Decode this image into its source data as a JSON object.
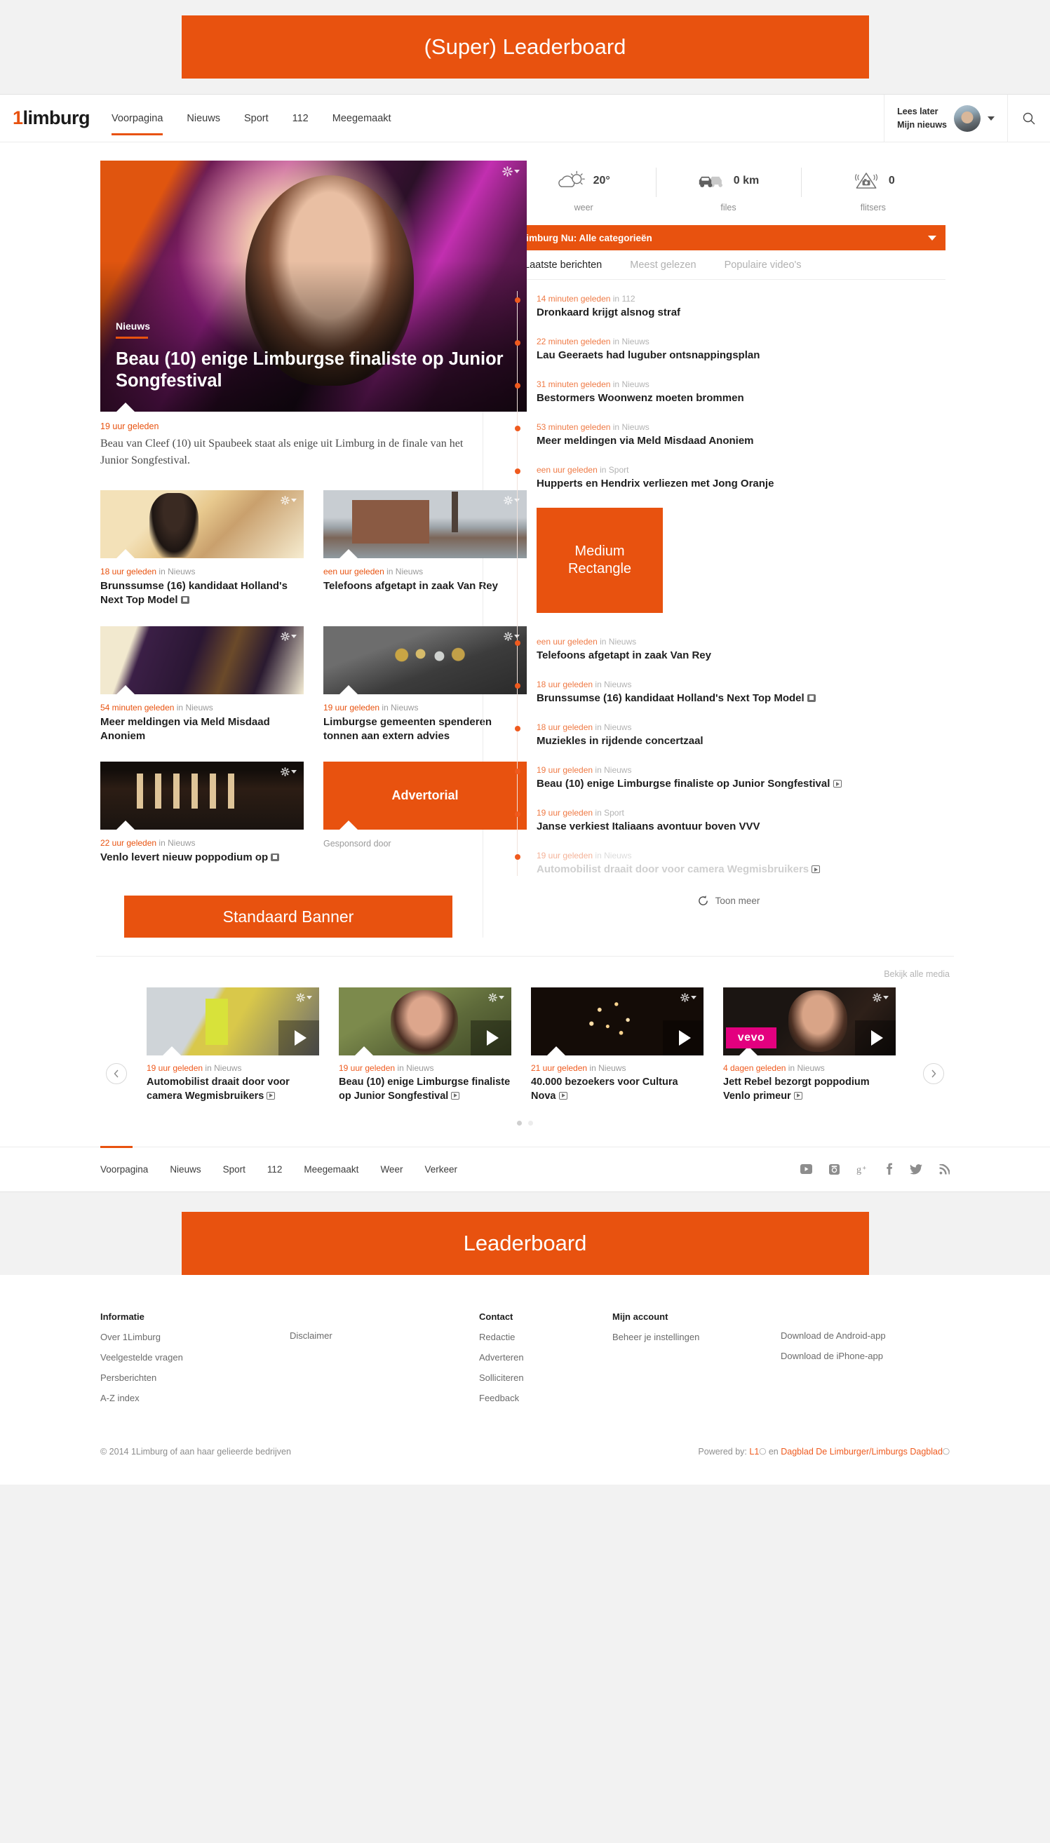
{
  "ads": {
    "super_leaderboard": "(Super) Leaderboard",
    "medium_rectangle_line1": "Medium",
    "medium_rectangle_line2": "Rectangle",
    "standaard_banner": "Standaard Banner",
    "leaderboard": "Leaderboard",
    "advertorial": "Advertorial",
    "advertorial_sub": "Gesponsord door"
  },
  "header": {
    "logo_one": "1",
    "logo_rest": "limburg",
    "nav": [
      {
        "label": "Voorpagina",
        "active": true
      },
      {
        "label": "Nieuws",
        "active": false
      },
      {
        "label": "Sport",
        "active": false
      },
      {
        "label": "112",
        "active": false
      },
      {
        "label": "Meegemaakt",
        "active": false
      }
    ],
    "user": {
      "read_later": "Lees later",
      "my_news": "Mijn nieuws"
    },
    "search_icon": "search-icon"
  },
  "hero": {
    "category": "Nieuws",
    "title": "Beau (10) enige Limburgse finaliste op Junior Songfestival",
    "time": "19 uur geleden",
    "lede": "Beau van Cleef (10) uit Spaubeek staat als enige uit Limburg in de finale van het Junior Songfestival."
  },
  "cards": [
    {
      "time": "18 uur geleden",
      "in": "in",
      "cat": "Nieuws",
      "title": "Brunssumse (16) kandidaat Holland's Next Top Model",
      "badge": "photo",
      "img": "img-a"
    },
    {
      "time": "een uur geleden",
      "in": "in",
      "cat": "Nieuws",
      "title": "Telefoons afgetapt in zaak Van Rey",
      "badge": "",
      "img": "img-b"
    },
    {
      "time": "54 minuten geleden",
      "in": "in",
      "cat": "Nieuws",
      "title": "Meer meldingen via Meld Misdaad Anoniem",
      "badge": "",
      "img": "img-c"
    },
    {
      "time": "19 uur geleden",
      "in": "in",
      "cat": "Nieuws",
      "title": "Limburgse gemeenten spenderen tonnen aan extern advies",
      "badge": "",
      "img": "img-d"
    },
    {
      "time": "22 uur geleden",
      "in": "in",
      "cat": "Nieuws",
      "title": "Venlo levert nieuw poppodium op",
      "badge": "photo",
      "img": "img-e"
    }
  ],
  "widgets": [
    {
      "icon": "weather-sun-cloud-icon",
      "value": "20°",
      "label": "weer"
    },
    {
      "icon": "car-traffic-icon",
      "value": "0 km",
      "label": "files"
    },
    {
      "icon": "speed-camera-icon",
      "value": "0",
      "label": "flitsers"
    }
  ],
  "category_bar": {
    "label": "Limburg Nu: Alle categorieën",
    "caret": "chevron-down-icon"
  },
  "tabs": [
    {
      "label": "Laatste berichten",
      "active": true
    },
    {
      "label": "Meest gelezen",
      "active": false
    },
    {
      "label": "Populaire video's",
      "active": false
    }
  ],
  "news_top": [
    {
      "time": "14 minuten geleden",
      "in": "in",
      "cat": "112",
      "title": "Dronkaard krijgt alsnog straf",
      "badge": ""
    },
    {
      "time": "22 minuten geleden",
      "in": "in",
      "cat": "Nieuws",
      "title": "Lau Geeraets had luguber ontsnappingsplan",
      "badge": ""
    },
    {
      "time": "31 minuten geleden",
      "in": "in",
      "cat": "Nieuws",
      "title": "Bestormers Woonwenz moeten brommen",
      "badge": ""
    },
    {
      "time": "53 minuten geleden",
      "in": "in",
      "cat": "Nieuws",
      "title": "Meer meldingen via Meld Misdaad Anoniem",
      "badge": ""
    },
    {
      "time": "een uur geleden",
      "in": "in",
      "cat": "Sport",
      "title": "Hupperts en Hendrix verliezen met Jong Oranje",
      "badge": ""
    }
  ],
  "news_bottom": [
    {
      "time": "een uur geleden",
      "in": "in",
      "cat": "Nieuws",
      "title": "Telefoons afgetapt in zaak Van Rey",
      "badge": "",
      "faded": false
    },
    {
      "time": "18 uur geleden",
      "in": "in",
      "cat": "Nieuws",
      "title": "Brunssumse (16) kandidaat Holland's Next Top Model",
      "badge": "photo",
      "faded": false
    },
    {
      "time": "18 uur geleden",
      "in": "in",
      "cat": "Nieuws",
      "title": "Muziekles in rijdende concertzaal",
      "badge": "",
      "faded": false
    },
    {
      "time": "19 uur geleden",
      "in": "in",
      "cat": "Nieuws",
      "title": "Beau (10) enige Limburgse finaliste op Junior Songfestival",
      "badge": "play",
      "faded": false
    },
    {
      "time": "19 uur geleden",
      "in": "in",
      "cat": "Sport",
      "title": "Janse verkiest Italiaans avontuur boven VVV",
      "badge": "",
      "faded": false
    },
    {
      "time": "19 uur geleden",
      "in": "in",
      "cat": "Nieuws",
      "title": "Automobilist draait door voor camera Wegmisbruikers",
      "badge": "play",
      "faded": true
    }
  ],
  "show_more": "Toon meer",
  "media": {
    "view_all": "Bekijk alle media",
    "prev_icon": "chevron-left-icon",
    "next_icon": "chevron-right-icon",
    "items": [
      {
        "time": "19 uur geleden",
        "in": "in",
        "cat": "Nieuws",
        "title": "Automobilist draait door voor camera Wegmisbruikers",
        "badge": "play",
        "img": "m-a"
      },
      {
        "time": "19 uur geleden",
        "in": "in",
        "cat": "Nieuws",
        "title": "Beau (10) enige Limburgse finaliste op Junior Songfestival",
        "badge": "play",
        "img": "m-b"
      },
      {
        "time": "21 uur geleden",
        "in": "in",
        "cat": "Nieuws",
        "title": "40.000 bezoekers voor Cultura Nova",
        "badge": "play",
        "img": "m-c"
      },
      {
        "time": "4 dagen geleden",
        "in": "in",
        "cat": "Nieuws",
        "title": "Jett Rebel bezorgt poppodium Venlo primeur",
        "badge": "play",
        "img": "m-d"
      }
    ]
  },
  "footer_nav": [
    "Voorpagina",
    "Nieuws",
    "Sport",
    "112",
    "Meegemaakt",
    "Weer",
    "Verkeer"
  ],
  "socials": [
    "youtube-icon",
    "instagram-icon",
    "googleplus-icon",
    "facebook-icon",
    "twitter-icon",
    "rss-icon"
  ],
  "footer": {
    "col1_head": "Informatie",
    "col1": [
      "Over 1Limburg",
      "Veelgestelde vragen",
      "Persberichten",
      "A-Z index"
    ],
    "col1b": [
      "Disclaimer"
    ],
    "col2_head": "Contact",
    "col2": [
      "Redactie",
      "Adverteren",
      "Solliciteren",
      "Feedback"
    ],
    "col3_head": "Mijn account",
    "col3": [
      "Beheer je instellingen"
    ],
    "col4": [
      "Download de Android-app",
      "Download de iPhone-app"
    ],
    "copyright": "© 2014 1Limburg of aan haar gelieerde bedrijven",
    "powered_prefix": "Powered by:",
    "powered_l1": "L1",
    "powered_en": "en",
    "powered_dagblad": "Dagblad De Limburger/Limburgs Dagblad"
  },
  "colors": {
    "accent": "#e8520f",
    "accent_light": "#ef5a1e"
  }
}
